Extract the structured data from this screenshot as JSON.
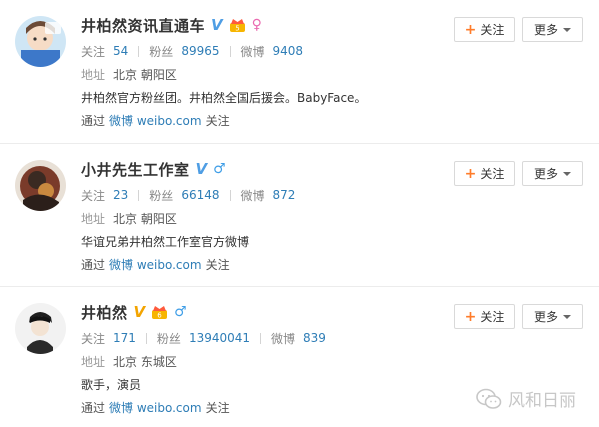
{
  "users": [
    {
      "name": "井柏然资讯直通车",
      "verified": "v-blue-icon",
      "extra_badges": [
        "crown-badge-icon"
      ],
      "gender": "♀",
      "stats": [
        {
          "label": "关注",
          "value": "54"
        },
        {
          "label": "粉丝",
          "value": "89965"
        },
        {
          "label": "微博",
          "value": "9408"
        }
      ],
      "address_label": "地址",
      "address": "北京 朝阳区",
      "bio": "井柏然官方粉丝团。井柏然全国后援会。BabyFace。",
      "via_prefix": "通过",
      "via_link": "微博 weibo.com",
      "via_suffix": "关注",
      "follow_label": "关注",
      "more_label": "更多"
    },
    {
      "name": "小井先生工作室",
      "verified": "v-blue-icon",
      "extra_badges": [],
      "gender": "♂",
      "stats": [
        {
          "label": "关注",
          "value": "23"
        },
        {
          "label": "粉丝",
          "value": "66148"
        },
        {
          "label": "微博",
          "value": "872"
        }
      ],
      "address_label": "地址",
      "address": "北京 朝阳区",
      "bio": "华谊兄弟井柏然工作室官方微博",
      "via_prefix": "通过",
      "via_link": "微博 weibo.com",
      "via_suffix": "关注",
      "follow_label": "关注",
      "more_label": "更多"
    },
    {
      "name": "井柏然",
      "verified": "v-gold-icon",
      "extra_badges": [
        "crown-badge-icon"
      ],
      "gender": "♂",
      "stats": [
        {
          "label": "关注",
          "value": "171"
        },
        {
          "label": "粉丝",
          "value": "13940041"
        },
        {
          "label": "微博",
          "value": "839"
        }
      ],
      "address_label": "地址",
      "address": "北京 东城区",
      "bio": "歌手，演员",
      "via_prefix": "通过",
      "via_link": "微博 weibo.com",
      "via_suffix": "关注",
      "follow_label": "关注",
      "more_label": "更多"
    }
  ],
  "watermark": "风和日丽",
  "colors": {
    "link": "#2e7db6",
    "plus": "#ff7c2a",
    "verified_blue": "#4f9ee4",
    "verified_gold": "#f3a400",
    "male": "#3f9ee7",
    "female": "#ea6bb1"
  }
}
